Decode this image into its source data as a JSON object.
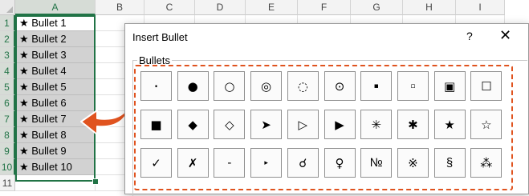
{
  "spreadsheet": {
    "columns": [
      "A",
      "B",
      "C",
      "D",
      "E",
      "F",
      "G",
      "H",
      "I"
    ],
    "rows": [
      "1",
      "2",
      "3",
      "4",
      "5",
      "6",
      "7",
      "8",
      "9",
      "10",
      "11"
    ],
    "cells": [
      "★ Bullet 1",
      "★ Bullet 2",
      "★ Bullet 3",
      "★ Bullet 4",
      "★ Bullet 5",
      "★ Bullet 6",
      "★ Bullet 7",
      "★ Bullet 8",
      "★ Bullet 9",
      "★ Bullet 10"
    ],
    "selection_color": "#217346",
    "arrow_color": "#e0531f"
  },
  "dialog": {
    "title": "Insert Bullet",
    "help": "?",
    "close": "✕",
    "group_label": "Bullets",
    "highlight_color": "#e0531f",
    "bullets": [
      [
        "·",
        "●",
        "○",
        "◎",
        "◌",
        "⊙",
        "▪",
        "▫",
        "▣",
        "☐"
      ],
      [
        "■",
        "◆",
        "◇",
        "➤",
        "▷",
        "▶",
        "✳",
        "✱",
        "★",
        "☆"
      ],
      [
        "✓",
        "✗",
        "-",
        "▸",
        "☌",
        "♀",
        "№",
        "※",
        "§",
        "⁂"
      ]
    ]
  }
}
